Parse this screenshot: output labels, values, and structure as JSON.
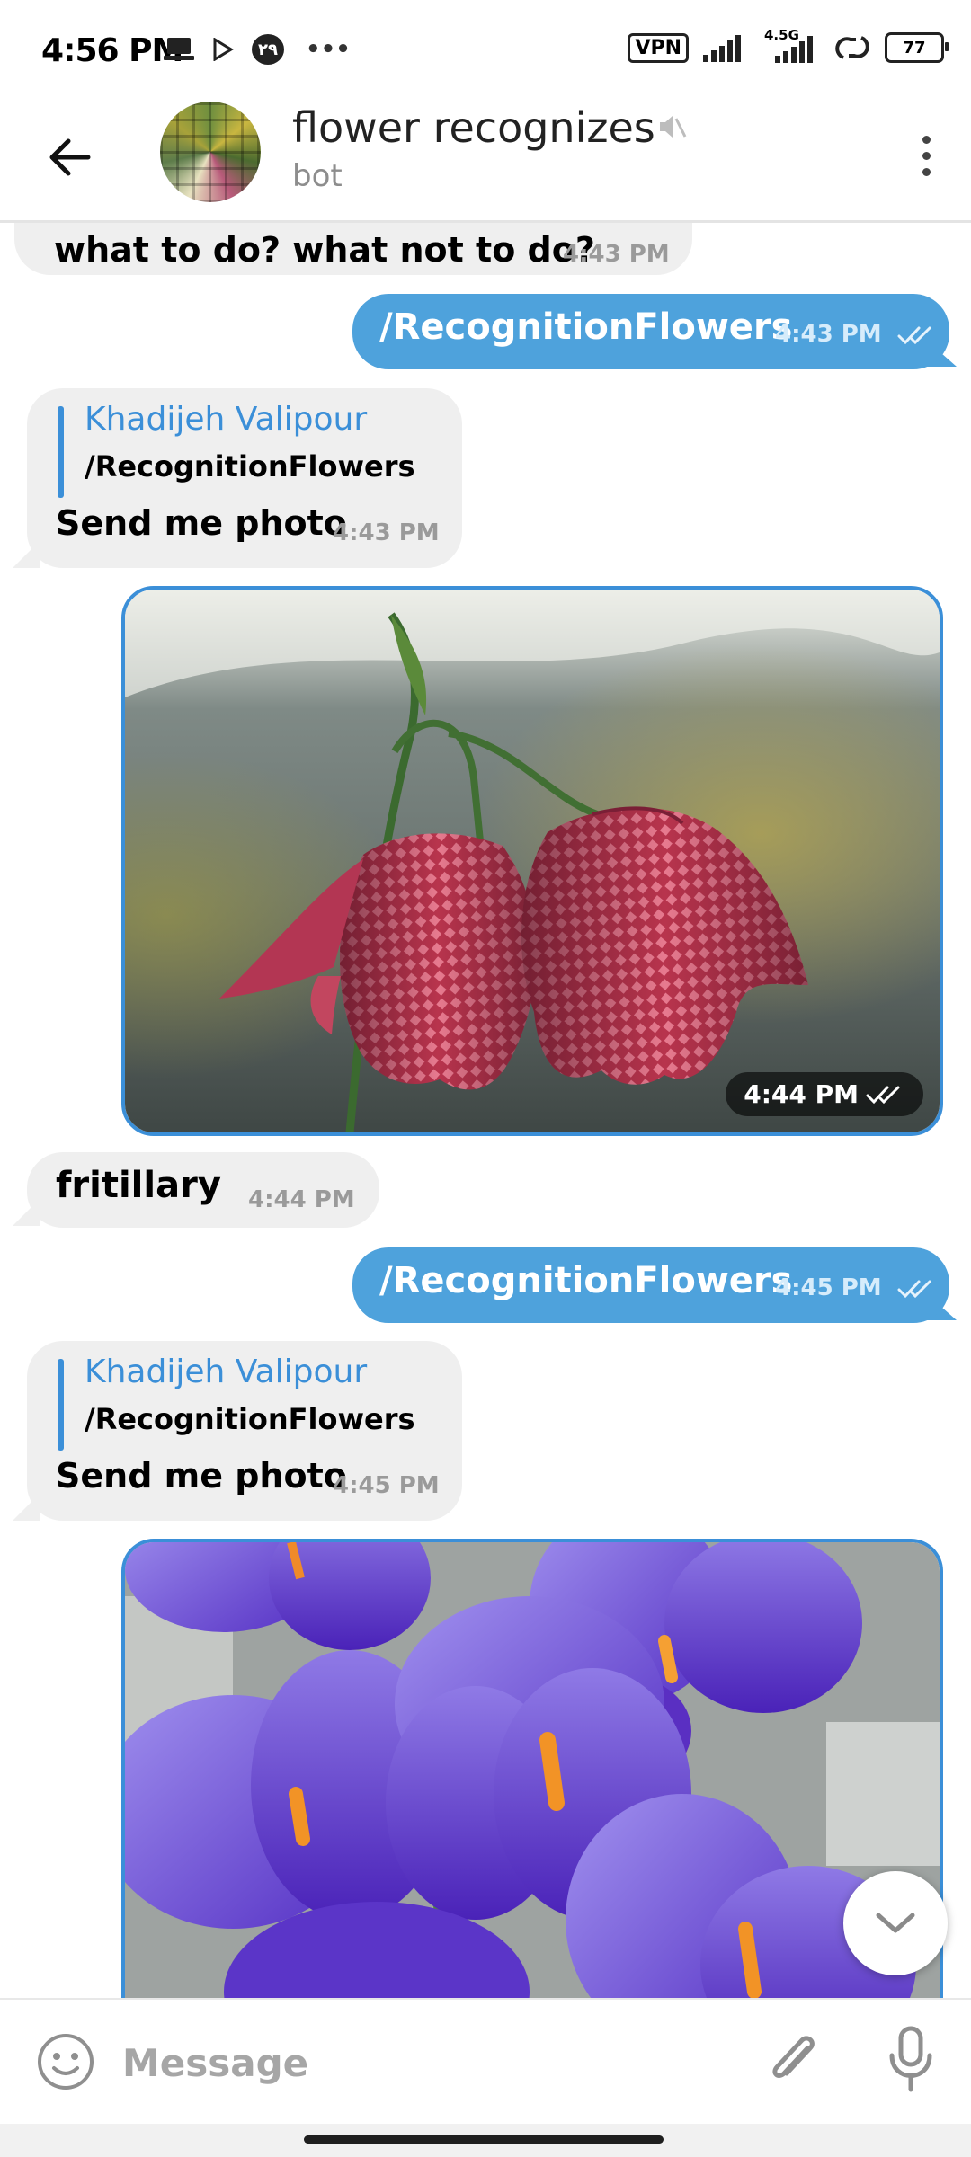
{
  "status_bar": {
    "time": "4:56 PM",
    "notif_badge": "۲۹",
    "more": "•••",
    "vpn": "VPN",
    "network": "4.5G",
    "battery": "77"
  },
  "header": {
    "title": "flower recognizes",
    "subtitle": "bot"
  },
  "messages": {
    "m1": {
      "text": "what to do? what not to do?",
      "time": "4:43 PM"
    },
    "m2": {
      "text": "/RecognitionFlowers",
      "time": "4:43 PM"
    },
    "m3": {
      "reply_name": "Khadijeh Valipour",
      "reply_text": "/RecognitionFlowers",
      "text": "Send me photo",
      "time": "4:43 PM"
    },
    "m4": {
      "time": "4:44 PM"
    },
    "m5": {
      "text": "fritillary",
      "time": "4:44 PM"
    },
    "m6": {
      "text": "/RecognitionFlowers",
      "time": "4:45 PM"
    },
    "m7": {
      "reply_name": "Khadijeh Valipour",
      "reply_text": "/RecognitionFlowers",
      "text": "Send me photo",
      "time": "4:45 PM"
    }
  },
  "input": {
    "placeholder": "Message",
    "value": ""
  },
  "colors": {
    "outgoing_bubble": "#4ea2dc",
    "incoming_bubble": "#efefef",
    "accent": "#3b8fd8"
  },
  "icons": [
    "back-arrow-icon",
    "mute-icon",
    "more-vert-icon",
    "double-check-icon",
    "chevron-down-icon",
    "emoji-icon",
    "paperclip-icon",
    "microphone-icon"
  ]
}
